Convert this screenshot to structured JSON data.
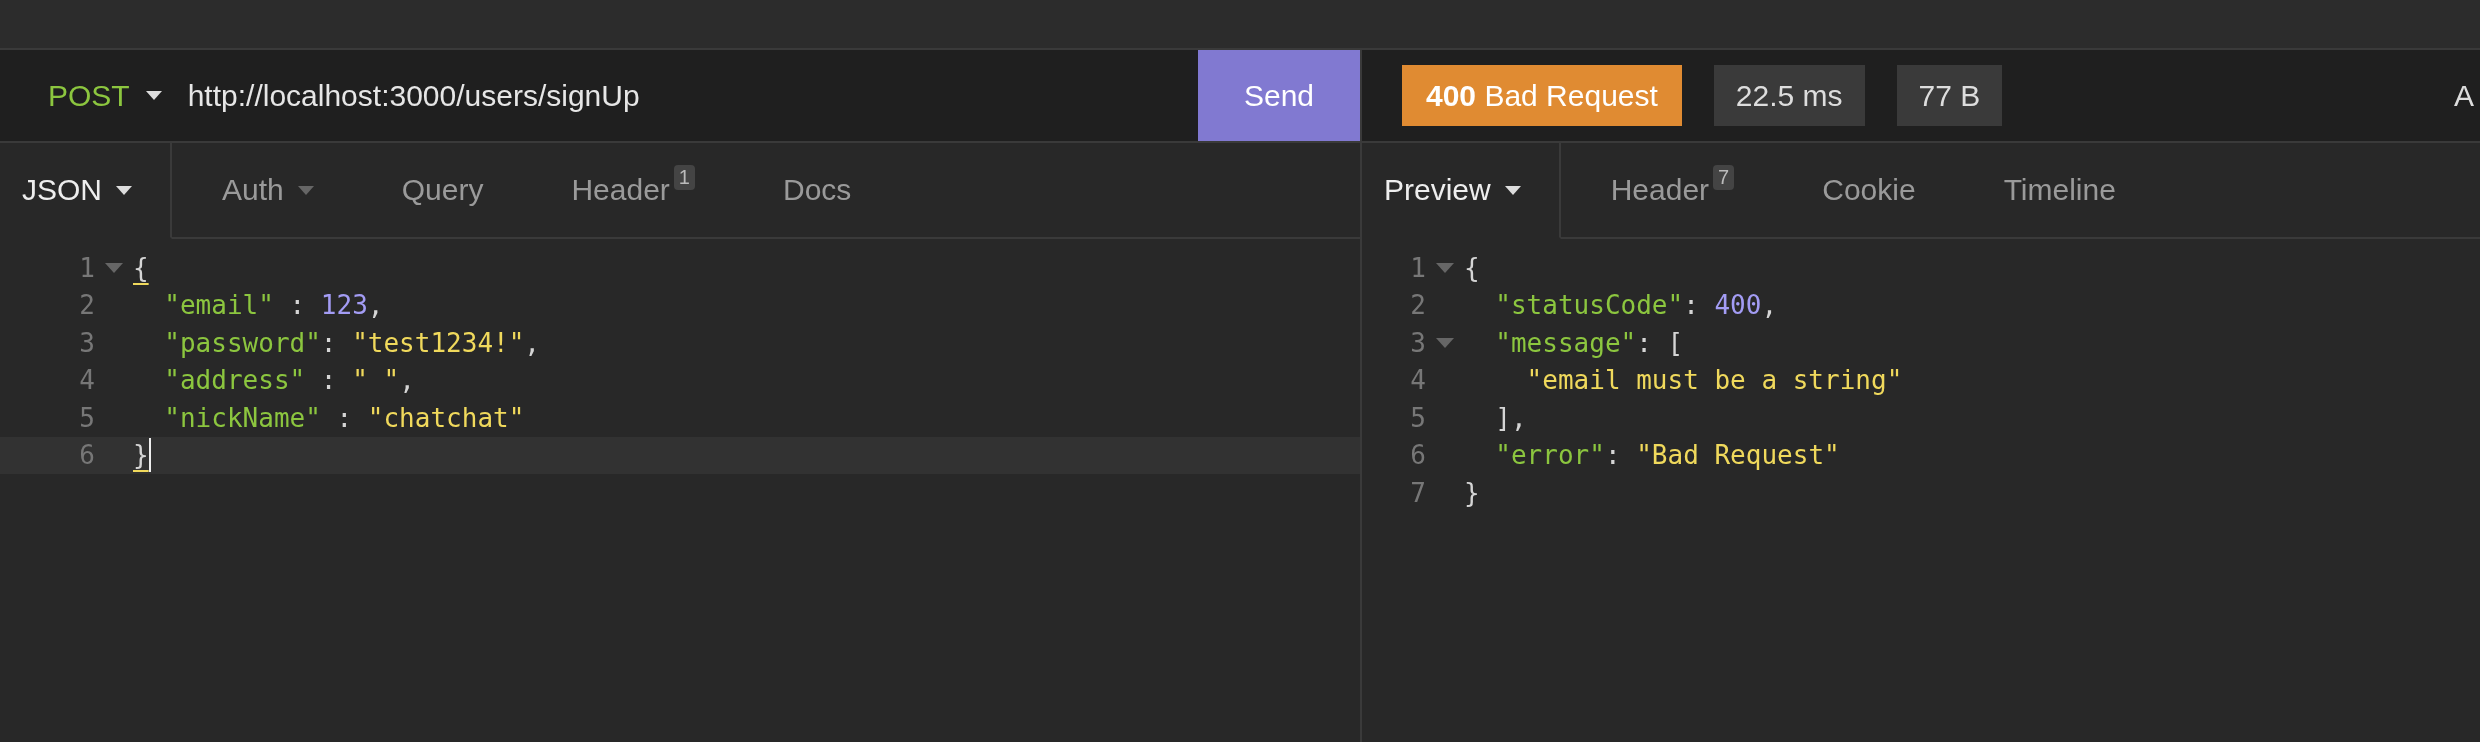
{
  "request": {
    "method": "POST",
    "url": "http://localhost:3000/users/signUp",
    "send_label": "Send",
    "tabs": [
      {
        "label": "JSON",
        "selected": true,
        "dropdown": true
      },
      {
        "label": "Auth",
        "selected": false,
        "dropdown": true
      },
      {
        "label": "Query",
        "selected": false
      },
      {
        "label": "Header",
        "selected": false,
        "badge": "1"
      },
      {
        "label": "Docs",
        "selected": false
      }
    ],
    "body": [
      {
        "number": "1",
        "fold": true,
        "active": false,
        "tokens": [
          {
            "kind": "match",
            "text": "{"
          }
        ]
      },
      {
        "number": "2",
        "fold": false,
        "active": false,
        "tokens": [
          {
            "kind": "key",
            "text": "  \"email\""
          },
          {
            "kind": "punct",
            "text": " : "
          },
          {
            "kind": "number",
            "text": "123"
          },
          {
            "kind": "punct",
            "text": ","
          }
        ]
      },
      {
        "number": "3",
        "fold": false,
        "active": false,
        "tokens": [
          {
            "kind": "key",
            "text": "  \"password\""
          },
          {
            "kind": "punct",
            "text": ": "
          },
          {
            "kind": "string",
            "text": "\"test1234!\""
          },
          {
            "kind": "punct",
            "text": ","
          }
        ]
      },
      {
        "number": "4",
        "fold": false,
        "active": false,
        "tokens": [
          {
            "kind": "key",
            "text": "  \"address\""
          },
          {
            "kind": "punct",
            "text": " : "
          },
          {
            "kind": "string",
            "text": "\" \""
          },
          {
            "kind": "punct",
            "text": ","
          }
        ]
      },
      {
        "number": "5",
        "fold": false,
        "active": false,
        "tokens": [
          {
            "kind": "key",
            "text": "  \"nickName\""
          },
          {
            "kind": "punct",
            "text": " : "
          },
          {
            "kind": "string",
            "text": "\"chatchat\""
          }
        ]
      },
      {
        "number": "6",
        "fold": false,
        "active": true,
        "tokens": [
          {
            "kind": "match",
            "text": "}"
          }
        ]
      }
    ]
  },
  "response": {
    "status_code": "400",
    "status_text": "Bad Request",
    "time": "22.5 ms",
    "size": "77 B",
    "cut_text": "A",
    "tabs": [
      {
        "label": "Preview",
        "selected": true,
        "dropdown": true
      },
      {
        "label": "Header",
        "selected": false,
        "badge": "7"
      },
      {
        "label": "Cookie",
        "selected": false
      },
      {
        "label": "Timeline",
        "selected": false
      }
    ],
    "body": [
      {
        "number": "1",
        "fold": true,
        "active": false,
        "tokens": [
          {
            "kind": "punct",
            "text": "{"
          }
        ]
      },
      {
        "number": "2",
        "fold": false,
        "active": false,
        "tokens": [
          {
            "kind": "key",
            "text": "  \"statusCode\""
          },
          {
            "kind": "punct",
            "text": ": "
          },
          {
            "kind": "number",
            "text": "400"
          },
          {
            "kind": "punct",
            "text": ","
          }
        ]
      },
      {
        "number": "3",
        "fold": true,
        "active": false,
        "tokens": [
          {
            "kind": "key",
            "text": "  \"message\""
          },
          {
            "kind": "punct",
            "text": ": ["
          }
        ]
      },
      {
        "number": "4",
        "fold": false,
        "active": false,
        "tokens": [
          {
            "kind": "string",
            "text": "    \"email must be a string\""
          }
        ]
      },
      {
        "number": "5",
        "fold": false,
        "active": false,
        "tokens": [
          {
            "kind": "punct",
            "text": "  ],"
          }
        ]
      },
      {
        "number": "6",
        "fold": false,
        "active": false,
        "tokens": [
          {
            "kind": "key",
            "text": "  \"error\""
          },
          {
            "kind": "punct",
            "text": ": "
          },
          {
            "kind": "string",
            "text": "\"Bad Request\""
          }
        ]
      },
      {
        "number": "7",
        "fold": false,
        "active": false,
        "tokens": [
          {
            "kind": "punct",
            "text": "}"
          }
        ]
      }
    ]
  }
}
